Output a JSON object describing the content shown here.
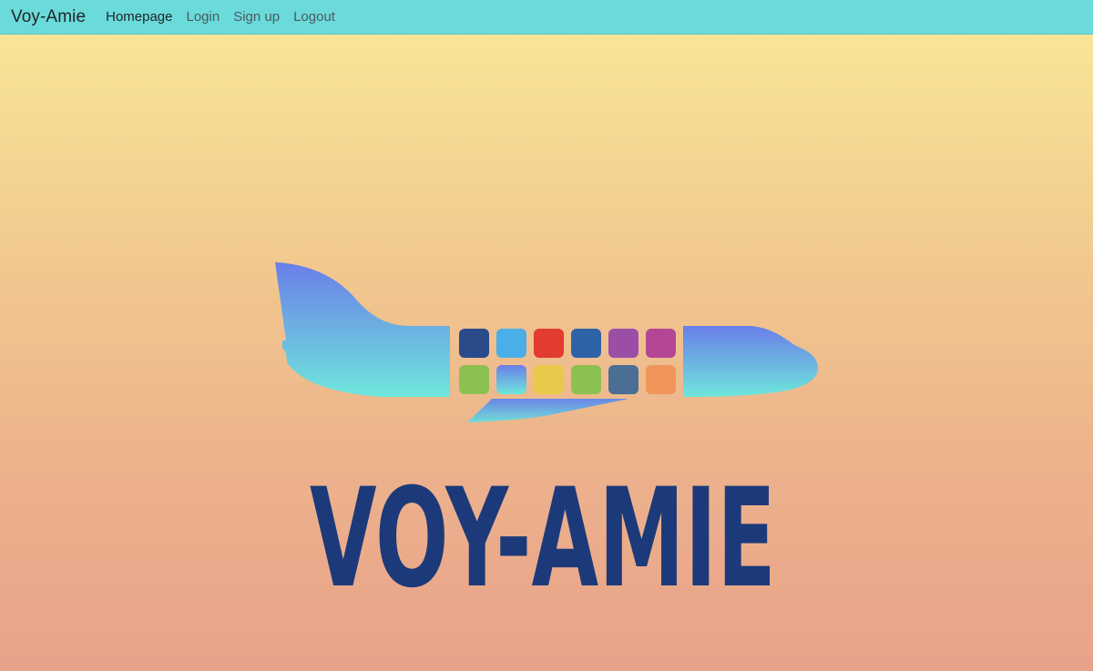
{
  "navbar": {
    "brand": "Voy-Amie",
    "links": [
      {
        "label": "Homepage",
        "active": true
      },
      {
        "label": "Login",
        "active": false
      },
      {
        "label": "Sign up",
        "active": false
      },
      {
        "label": "Logout",
        "active": false
      }
    ]
  },
  "hero": {
    "logo_wordmark": "VOY-AMIE",
    "logo_icon": "airplane-icon",
    "window_colors": [
      [
        "#2b4a8a",
        "#4aaee8",
        "#e23b30",
        "#2e63a8",
        "#9b4ea6",
        "#b44696"
      ],
      [
        "#8cc152",
        "gradient",
        "#e8c94a",
        "#8cc152",
        "#4a6e94",
        "#f0965a"
      ]
    ]
  },
  "colors": {
    "navbar_bg": "#6bdada",
    "wordmark": "#1c3a7a",
    "plane_top": "#6a7ee8",
    "plane_bottom": "#6ee6dc"
  }
}
